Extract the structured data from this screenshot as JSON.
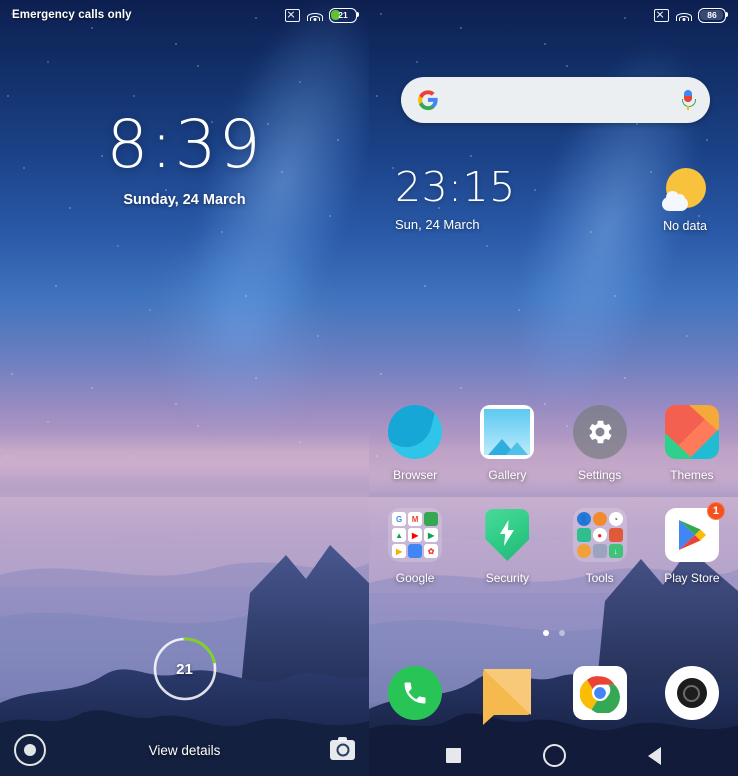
{
  "lock_screen": {
    "status_bar": {
      "carrier": "Emergency calls only",
      "battery_level": "21",
      "icons": [
        "no-sim-icon",
        "wifi-icon",
        "battery-icon"
      ]
    },
    "time": "8:39",
    "date": "Sunday, 24 March",
    "battery_ring": {
      "percent": "21",
      "ring_color": "#7ed321"
    },
    "view_details_label": "View details",
    "shortcuts": {
      "left": "torch-icon",
      "right": "camera-icon"
    }
  },
  "home_screen": {
    "status_bar": {
      "battery_level": "86",
      "icons": [
        "no-sim-icon",
        "wifi-icon",
        "battery-icon"
      ]
    },
    "search": {
      "placeholder": "",
      "value": "",
      "left_icon": "google-g-icon",
      "right_icon": "microphone-icon"
    },
    "clock_widget": {
      "time": "23:15",
      "date": "Sun, 24 March"
    },
    "weather_widget": {
      "status": "No data",
      "icon": "sun-behind-cloud-icon"
    },
    "app_rows": [
      [
        {
          "label": "Browser",
          "icon": "browser-icon",
          "badge": ""
        },
        {
          "label": "Gallery",
          "icon": "gallery-icon",
          "badge": ""
        },
        {
          "label": "Settings",
          "icon": "settings-gear-icon",
          "badge": ""
        },
        {
          "label": "Themes",
          "icon": "themes-icon",
          "badge": ""
        }
      ],
      [
        {
          "label": "Google",
          "icon": "google-folder-icon",
          "badge": ""
        },
        {
          "label": "Security",
          "icon": "security-shield-icon",
          "badge": ""
        },
        {
          "label": "Tools",
          "icon": "tools-folder-icon",
          "badge": ""
        },
        {
          "label": "Play Store",
          "icon": "play-store-icon",
          "badge": "1"
        }
      ]
    ],
    "google_folder_apps": [
      "Google",
      "Gmail",
      "Maps",
      "Drive",
      "YouTube",
      "Play Movies",
      "Slides",
      "Duo",
      "Photos"
    ],
    "tools_folder_apps": [
      "Mi Account",
      "Downloads",
      "Compass",
      "Notes",
      "Recorder",
      "Screen Recorder",
      "Scanner",
      "Calculator",
      "Mi Drop"
    ],
    "page_indicator": {
      "pages": 2,
      "active": 1
    },
    "dock": [
      {
        "label": "Phone",
        "icon": "phone-icon"
      },
      {
        "label": "Messages",
        "icon": "messages-icon"
      },
      {
        "label": "Chrome",
        "icon": "chrome-icon"
      },
      {
        "label": "Camera",
        "icon": "camera-icon"
      }
    ],
    "nav_bar": [
      {
        "label": "Recents",
        "icon": "square-recents-icon"
      },
      {
        "label": "Home",
        "icon": "circle-home-icon"
      },
      {
        "label": "Back",
        "icon": "triangle-back-icon"
      }
    ]
  },
  "colors": {
    "accent_green": "#7ed321",
    "badge": "#f4511e",
    "sky_top": "#0d1f50",
    "sky_mid": "#2a5aa8"
  }
}
